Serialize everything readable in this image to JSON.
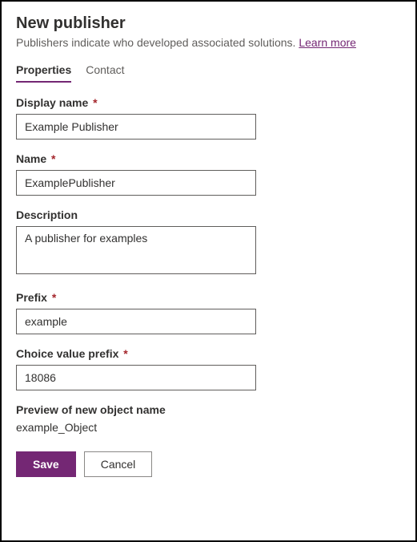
{
  "header": {
    "title": "New publisher",
    "subtitle_text": "Publishers indicate who developed associated solutions. ",
    "learn_more": "Learn more"
  },
  "tabs": {
    "properties": "Properties",
    "contact": "Contact"
  },
  "fields": {
    "display_name": {
      "label": "Display name",
      "value": "Example Publisher"
    },
    "name": {
      "label": "Name",
      "value": "ExamplePublisher"
    },
    "description": {
      "label": "Description",
      "value": "A publisher for examples"
    },
    "prefix": {
      "label": "Prefix",
      "value": "example"
    },
    "choice_prefix": {
      "label": "Choice value prefix",
      "value": "18086"
    },
    "preview": {
      "label": "Preview of new object name",
      "value": "example_Object"
    }
  },
  "footer": {
    "save": "Save",
    "cancel": "Cancel"
  },
  "required_marker": "*"
}
